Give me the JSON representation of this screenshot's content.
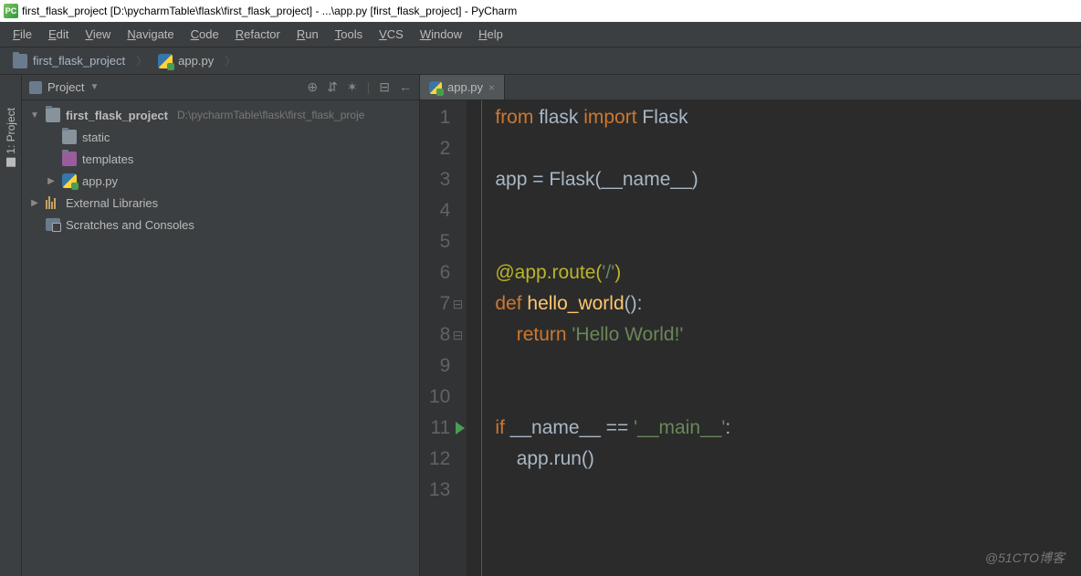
{
  "window": {
    "title": "first_flask_project [D:\\pycharmTable\\flask\\first_flask_project] - ...\\app.py [first_flask_project] - PyCharm",
    "icon_text": "PC"
  },
  "menu": {
    "items": [
      "File",
      "Edit",
      "View",
      "Navigate",
      "Code",
      "Refactor",
      "Run",
      "Tools",
      "VCS",
      "Window",
      "Help"
    ]
  },
  "breadcrumb": {
    "root": "first_flask_project",
    "file": "app.py"
  },
  "side_tab": {
    "label": "1: Project"
  },
  "panel": {
    "title": "Project",
    "tools": [
      "⊕",
      "⇵",
      "✶",
      "⊟",
      "←"
    ]
  },
  "tree": {
    "root": {
      "name": "first_flask_project",
      "location": "D:\\pycharmTable\\flask\\first_flask_proje"
    },
    "static": "static",
    "templates": "templates",
    "app": "app.py",
    "ext": "External Libraries",
    "scratch": "Scratches and Consoles"
  },
  "tab": {
    "file": "app.py"
  },
  "code": {
    "lines": [
      [
        {
          "t": "from ",
          "c": "kw"
        },
        {
          "t": "flask ",
          "c": "nm"
        },
        {
          "t": "import ",
          "c": "kw"
        },
        {
          "t": "Flask",
          "c": "nm"
        }
      ],
      [],
      [
        {
          "t": "app = Flask(",
          "c": "nm"
        },
        {
          "t": "__name__",
          "c": "nm"
        },
        {
          "t": ")",
          "c": "nm"
        }
      ],
      [],
      [],
      [
        {
          "t": "@app.route(",
          "c": "dec"
        },
        {
          "t": "'/'",
          "c": "str"
        },
        {
          "t": ")",
          "c": "dec"
        }
      ],
      [
        {
          "t": "def ",
          "c": "kw"
        },
        {
          "t": "hello_world",
          "c": "fn"
        },
        {
          "t": "():",
          "c": "nm"
        }
      ],
      [
        {
          "t": "    ",
          "c": "nm"
        },
        {
          "t": "return ",
          "c": "kw"
        },
        {
          "t": "'Hello World!'",
          "c": "str"
        }
      ],
      [],
      [],
      [
        {
          "t": "if ",
          "c": "kw"
        },
        {
          "t": "__name__ == ",
          "c": "nm"
        },
        {
          "t": "'__main__'",
          "c": "str"
        },
        {
          "t": ":",
          "c": "nm"
        }
      ],
      [
        {
          "t": "    app.run()",
          "c": "nm"
        }
      ],
      []
    ],
    "run_line": 11,
    "fold_lines": [
      7,
      8
    ]
  },
  "watermark": "@51CTO博客"
}
